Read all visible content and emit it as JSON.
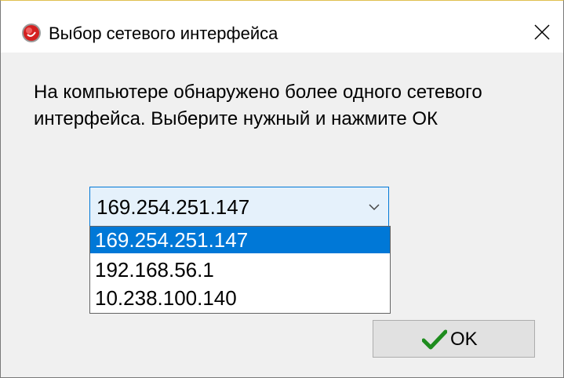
{
  "window": {
    "title": "Выбор сетевого интерфейса",
    "icon": "app-logo-icon",
    "close_icon": "close-icon"
  },
  "dialog": {
    "message": "На компьютере обнаружено более одного сетевого интерфейса. Выберите нужный и нажмите ОК"
  },
  "combo": {
    "selected_value": "169.254.251.147",
    "arrow_icon": "chevron-down-icon",
    "options": [
      "169.254.251.147",
      "192.168.56.1",
      "10.238.100.140"
    ],
    "highlighted_index": 0
  },
  "ok_button": {
    "label": "OK",
    "icon": "checkmark-icon",
    "icon_color": "#1e8c1e"
  },
  "colors": {
    "accent": "#0078d7",
    "app_icon_red": "#d42020"
  }
}
